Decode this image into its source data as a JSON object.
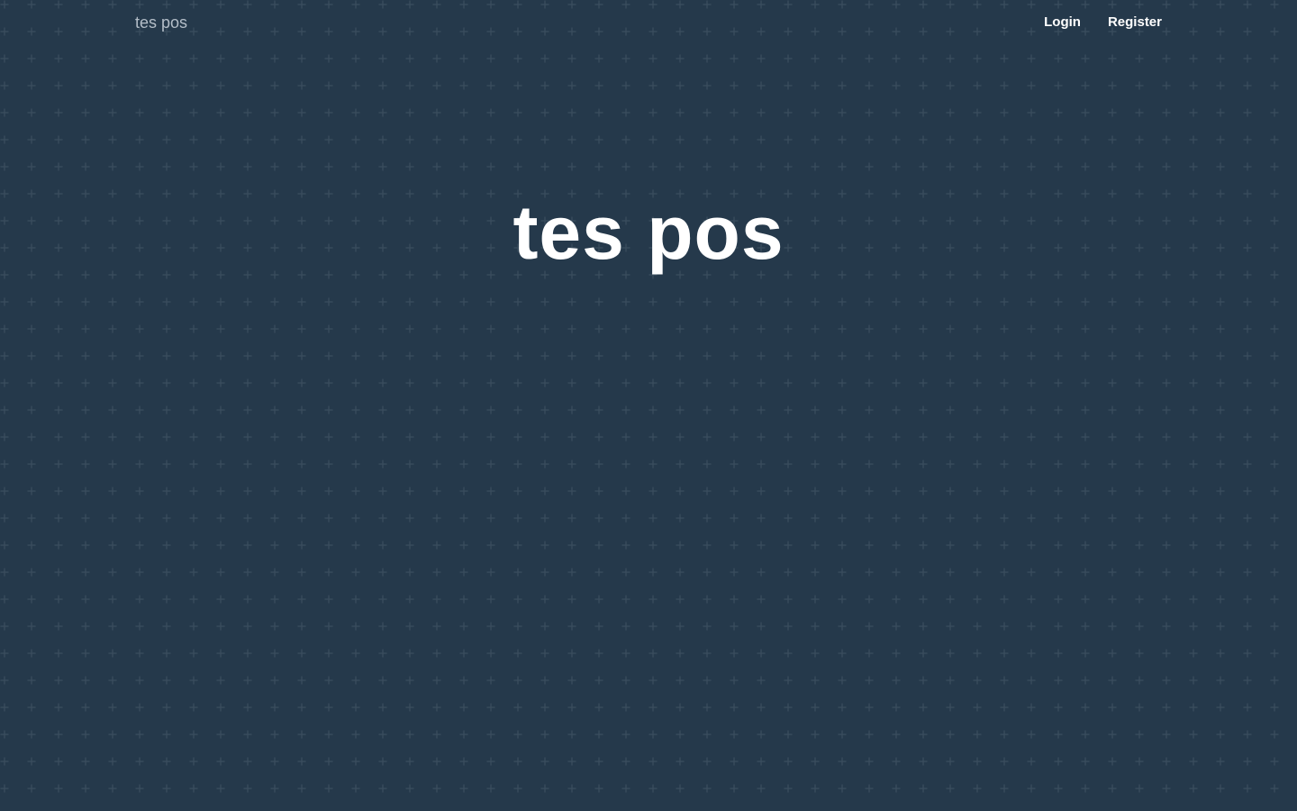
{
  "header": {
    "brand": "tes pos",
    "nav": {
      "login_label": "Login",
      "register_label": "Register"
    }
  },
  "hero": {
    "title": "tes pos"
  },
  "colors": {
    "background": "#25394b",
    "pattern": "#3a4d5e",
    "brand_text": "#b4bec8",
    "text": "#ffffff"
  }
}
